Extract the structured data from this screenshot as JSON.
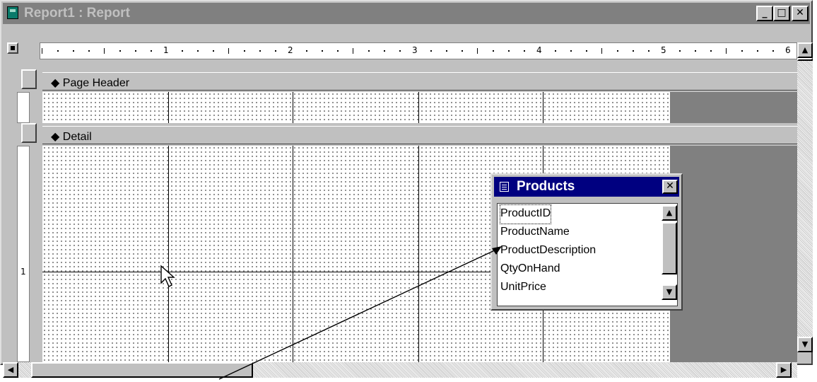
{
  "window": {
    "title": "Report1 : Report",
    "min_btn": "_",
    "max_btn": "□",
    "close_btn": "✕"
  },
  "ruler": {
    "marks": [
      "1",
      "2",
      "3",
      "4",
      "5",
      "6"
    ]
  },
  "vruler": {
    "marks": [
      "1"
    ]
  },
  "sections": {
    "page_header": "Page Header",
    "detail": "Detail"
  },
  "field_list": {
    "title": "Products",
    "close": "✕",
    "fields": [
      "ProductID",
      "ProductName",
      "ProductDescription",
      "QtyOnHand",
      "UnitPrice"
    ],
    "selected_index": 0
  },
  "scrollbars": {
    "up": "▲",
    "down": "▼",
    "left": "◀",
    "right": "▶"
  }
}
